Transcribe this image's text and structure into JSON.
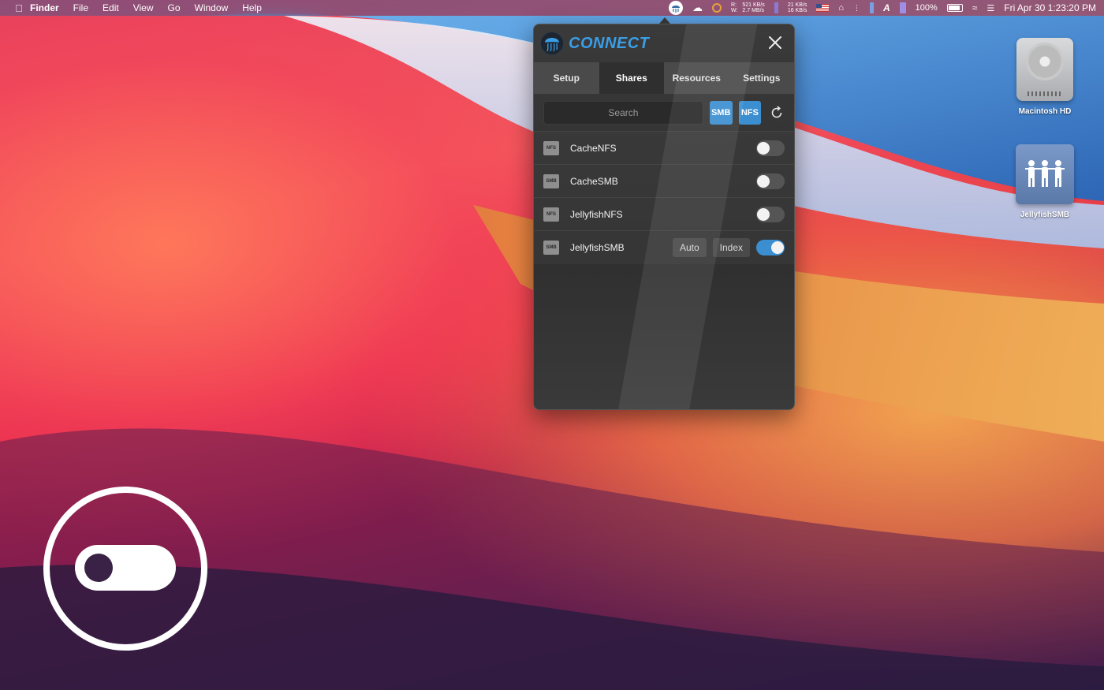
{
  "menubar": {
    "app_name": "Finder",
    "items": [
      "File",
      "Edit",
      "View",
      "Go",
      "Window",
      "Help"
    ],
    "net_read_label": "R:",
    "net_write_label": "W:",
    "net_read": "521 KB/s",
    "net_write": "2.7 MB/s",
    "net_up": "21 KB/s",
    "net_down": "16 KB/s",
    "battery_percent": "100%",
    "datetime": "Fri Apr 30  1:23:20 PM"
  },
  "connect": {
    "brand": "CONNECT",
    "tabs": [
      {
        "label": "Setup",
        "active": false
      },
      {
        "label": "Shares",
        "active": true
      },
      {
        "label": "Resources",
        "active": false
      },
      {
        "label": "Settings",
        "active": false
      }
    ],
    "search_placeholder": "Search",
    "filter_smb": "SMB",
    "filter_nfs": "NFS",
    "shares": [
      {
        "protocol": "NFS",
        "name": "CacheNFS",
        "enabled": false
      },
      {
        "protocol": "SMB",
        "name": "CacheSMB",
        "enabled": false
      },
      {
        "protocol": "NFS",
        "name": "JellyfishNFS",
        "enabled": false
      },
      {
        "protocol": "SMB",
        "name": "JellyfishSMB",
        "enabled": true,
        "auto_label": "Auto",
        "index_label": "Index"
      }
    ],
    "accent_color": "#3b8fd1"
  },
  "desktop": {
    "icons": [
      {
        "label": "Macintosh HD",
        "icon": "hard-drive-icon"
      },
      {
        "label": "JellyfishSMB",
        "icon": "network-share-icon"
      }
    ]
  },
  "overlay": {
    "icon": "toggle-switch-icon"
  }
}
